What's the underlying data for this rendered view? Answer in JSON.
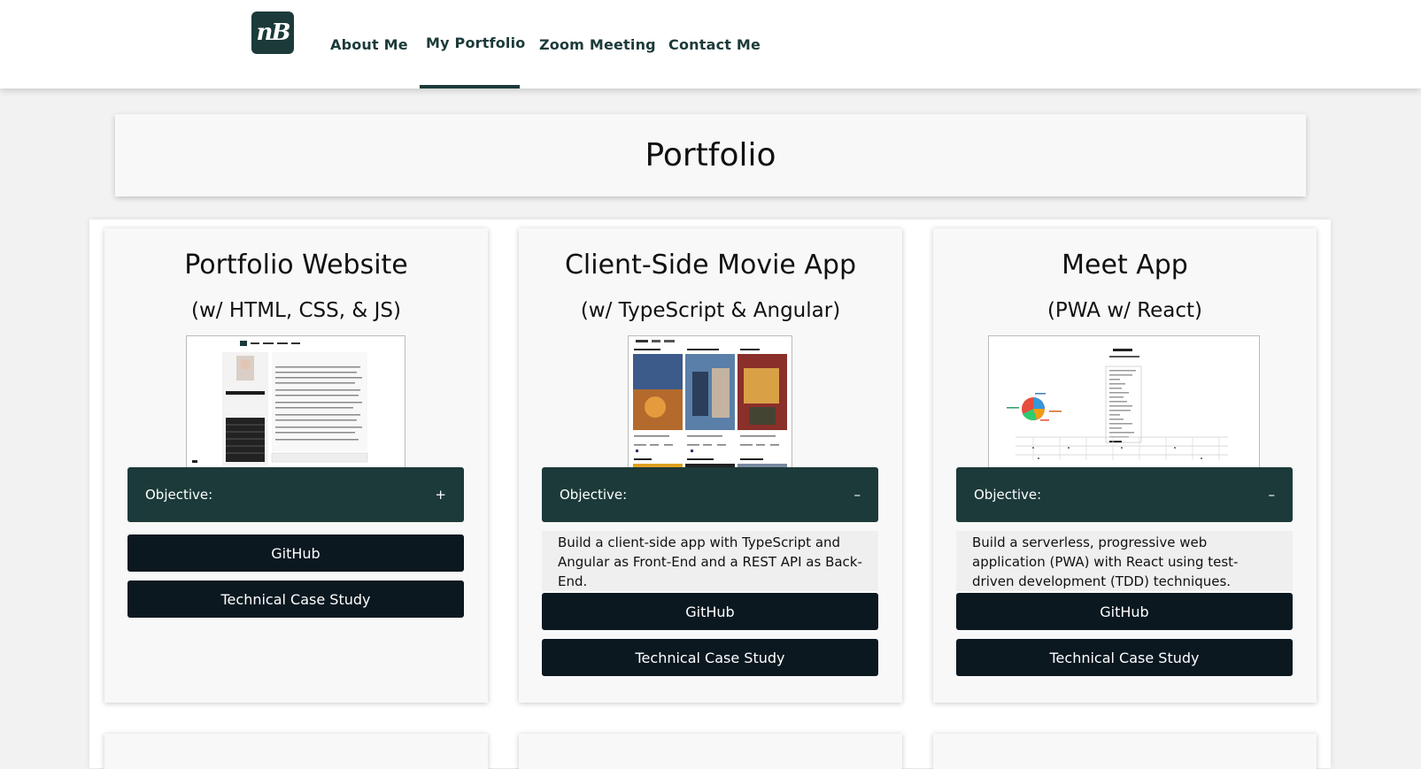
{
  "nav": {
    "logo_text": "nB",
    "links": [
      "About Me",
      "My Portfolio",
      "Zoom Meeting",
      "Contact Me"
    ],
    "active": "My Portfolio"
  },
  "page_title": "Portfolio",
  "cards": [
    {
      "title": "Portfolio Website",
      "subtitle": "(w/ HTML, CSS, & JS)",
      "objective_label": "Objective:",
      "toggle": "+",
      "description": "",
      "github_label": "GitHub",
      "case_study_label": "Technical Case Study"
    },
    {
      "title": "Client-Side Movie App",
      "subtitle": "(w/ TypeScript & Angular)",
      "objective_label": "Objective:",
      "toggle": "–",
      "description": "Build a client-side app with TypeScript and Angular as Front-End and a REST API as Back-End.",
      "github_label": "GitHub",
      "case_study_label": "Technical Case Study"
    },
    {
      "title": "Meet App",
      "subtitle": "(PWA w/ React)",
      "objective_label": "Objective:",
      "toggle": "–",
      "description": "Build a serverless, progressive web application (PWA) with React using test-driven development (TDD) techniques.",
      "github_label": "GitHub",
      "case_study_label": "Technical Case Study"
    }
  ],
  "colors": {
    "accent": "#1c3a3a",
    "button": "#0b1820",
    "card_bg": "#f8f8f8"
  }
}
